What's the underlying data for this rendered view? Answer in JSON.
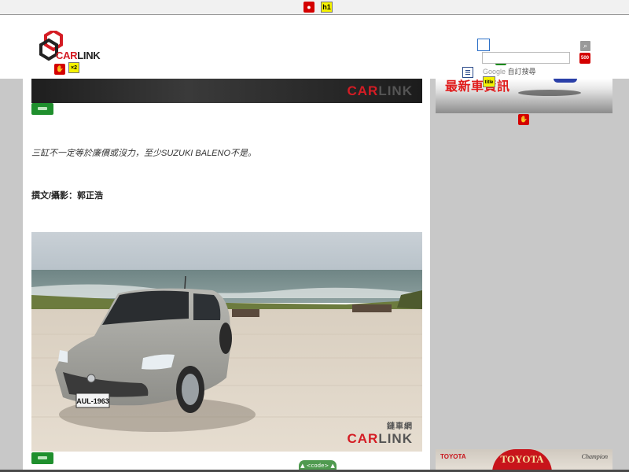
{
  "toolbar": {
    "comment_icon": "comment-icon",
    "h1_label": "h1"
  },
  "header": {
    "logo": {
      "prefix": "CAR",
      "suffix": "LINK"
    },
    "logo_badge_text": "×2",
    "search": {
      "placeholder": "",
      "google_brand": "Google",
      "label": "自訂搜尋",
      "button_icon": "search-icon"
    },
    "badge_title": "title",
    "badge_500": "500"
  },
  "banner": {
    "watermark_prefix": "CAR",
    "watermark_suffix": "LINK"
  },
  "article": {
    "intro": "三缸不一定等於廉價或沒力，至少SUZUKI BALENO不是。",
    "byline": "撰文/攝影：郭正浩",
    "photo": {
      "plate": "AUL-1963",
      "watermark_cn": "鏈車網",
      "watermark_prefix": "CAR",
      "watermark_suffix": "LINK"
    }
  },
  "code_toggle": {
    "label": "▲ <code> ▲"
  },
  "sidebar": {
    "news_title": "最新車",
    "news_title_2": "資訊"
  },
  "bottom_ad": {
    "left": "TOYOTA",
    "center": "TOYOTA",
    "right": "Champion"
  },
  "colors": {
    "brand_red": "#d41c24",
    "green_tag": "#1f8f2d",
    "page_bg": "#c8c8c8"
  }
}
